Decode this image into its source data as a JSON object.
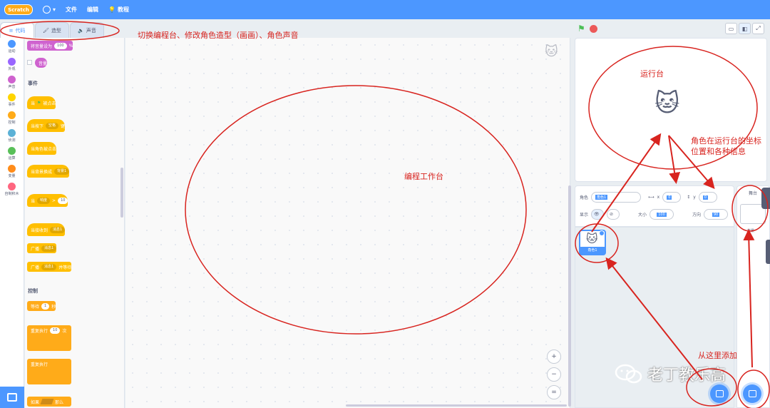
{
  "menubar": {
    "logo": "Scratch",
    "file": "文件",
    "edit": "编辑",
    "tutorials": "教程"
  },
  "tabs": [
    {
      "label": "代码",
      "icon": "code-icon"
    },
    {
      "label": "造型",
      "icon": "brush-icon"
    },
    {
      "label": "声音",
      "icon": "speaker-icon"
    }
  ],
  "categories": [
    {
      "label": "运动",
      "color": "#4c97ff"
    },
    {
      "label": "外观",
      "color": "#9966ff"
    },
    {
      "label": "声音",
      "color": "#cf63cf"
    },
    {
      "label": "事件",
      "color": "#ffd500"
    },
    {
      "label": "控制",
      "color": "#ffab19"
    },
    {
      "label": "侦测",
      "color": "#5cb1d6"
    },
    {
      "label": "运算",
      "color": "#59c059"
    },
    {
      "label": "变量",
      "color": "#ff8c1a"
    },
    {
      "label": "自制积木",
      "color": "#ff6680"
    }
  ],
  "palette": {
    "volume_block": "将音量设为",
    "volume_value": "100",
    "volume_unit": "%",
    "volume_reporter": "音量",
    "events_title": "事件",
    "when_flag": "当",
    "when_flag_suffix": "被点击",
    "when_key": "当按下",
    "key_value": "空格",
    "key_suffix": "键",
    "when_sprite_clicked": "当角色被点击",
    "when_backdrop": "当背景换成",
    "backdrop_value": "背景1",
    "when_loudness": "当",
    "loudness_value": "响度",
    "loudness_op": ">",
    "loudness_num": "10",
    "when_receive": "当接收到",
    "message_value": "消息1",
    "broadcast": "广播",
    "broadcast_value": "消息1",
    "broadcast_wait": "广播",
    "broadcast_wait_value": "消息1",
    "broadcast_wait_suffix": "并等待",
    "control_title": "控制",
    "wait": "等待",
    "wait_value": "1",
    "wait_unit": "秒",
    "repeat": "重复执行",
    "repeat_value": "10",
    "repeat_unit": "次",
    "forever": "重复执行",
    "if_label": "如果",
    "then_label": "那么"
  },
  "workspace": {
    "zoom_in": "+",
    "zoom_out": "−",
    "zoom_reset": "="
  },
  "sprite_info": {
    "sprite_label": "角色",
    "sprite_name": "角色1",
    "x_label": "x",
    "x_value": "0",
    "y_label": "y",
    "y_value": "0",
    "show_label": "显示",
    "size_label": "大小",
    "size_value": "100",
    "direction_label": "方向",
    "direction_value": "90"
  },
  "sprite_list": {
    "sprite_name": "角色1"
  },
  "stage_panel": {
    "title": "舞台",
    "backdrops_label": "背景",
    "backdrops_count": "1"
  },
  "annotations": {
    "tabs_note": "切换编程台、修改角色造型（画画）、角色声音",
    "workspace_note": "编程工作台",
    "stage_note": "运行台",
    "sprite_info_note_1": "角色在运行台的坐标",
    "sprite_info_note_2": "位置和各种信息",
    "add_note": "从这里添加"
  },
  "watermark": {
    "text": "老丁教乐高"
  }
}
